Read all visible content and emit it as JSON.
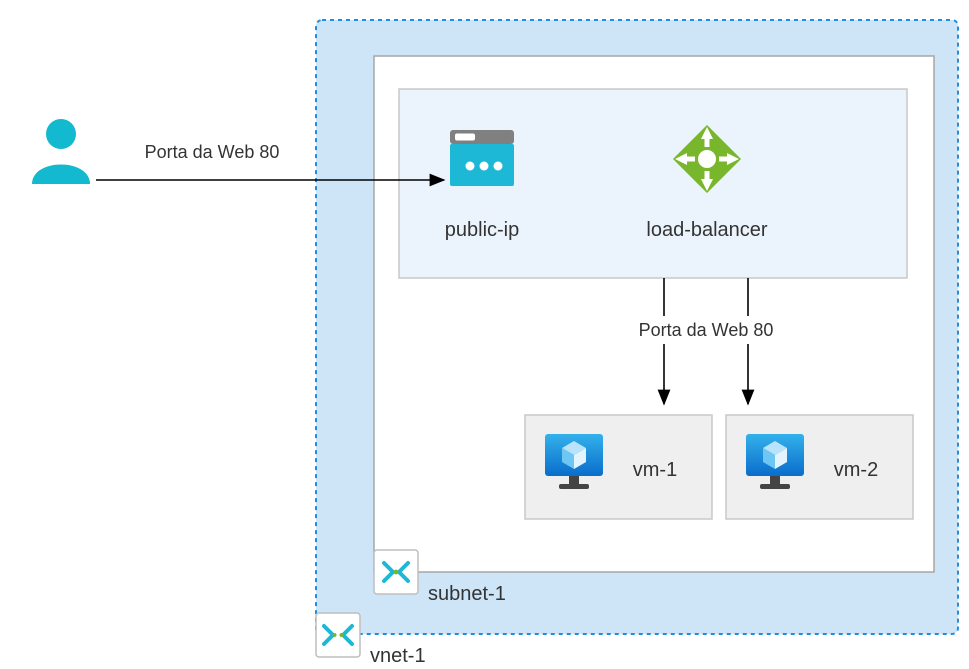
{
  "user_to_lb_label": "Porta da Web 80",
  "lb_to_vm_label": "Porta da Web 80",
  "public_ip_label": "public-ip",
  "load_balancer_label": "load-balancer",
  "vm1_label": "vm-1",
  "vm2_label": "vm-2",
  "subnet_label": "subnet-1",
  "vnet_label": "vnet-1",
  "colors": {
    "vnet_fill": "#CDE5F7",
    "vnet_stroke": "#1F8DE0",
    "subnet_fill": "#FFFFFF",
    "subnet_stroke": "#A6A6A6",
    "inner_box_fill": "#EBF4FC",
    "inner_box_stroke": "#C8C8C8",
    "vm_box_fill": "#EFEFEF",
    "vm_box_stroke": "#C8C8C8",
    "user_primary": "#13B9CE",
    "lb_green": "#78B62C",
    "vm_blue_dark": "#0A6DCB",
    "vm_blue_light": "#34B1EB",
    "icon_border": "#BEBEBE"
  }
}
